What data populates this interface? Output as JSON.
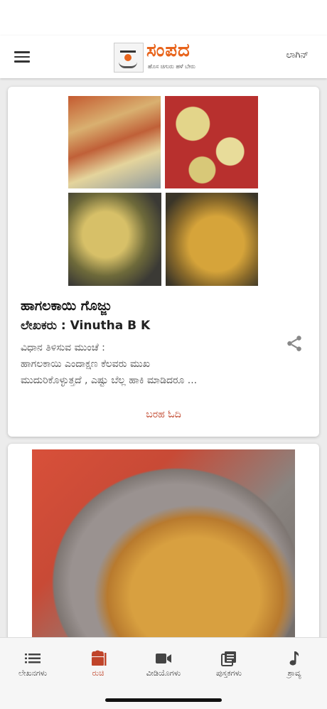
{
  "header": {
    "logo_title": "ಸಂಪದ",
    "logo_tagline": "ಹೊಸ ಚಿಗುರು ಹಳೆ ಬೇರು",
    "login_label": "ಲಾಗಿನ್"
  },
  "posts": [
    {
      "title": "ಹಾಗಲಕಾಯಿ ಗೊಜ್ಜು",
      "author": "ಲೇಖಕರು : Vinutha B K",
      "excerpt": [
        "ವಿಧಾನ ತಿಳಿಸುವ ಮುಂಚೆ :",
        "ಹಾಗಲಕಾಯಿ ಎಂದಾಕ್ಷಣ ಕೆಲವರು ಮುಖ",
        "ಮುದುರಿಕೊಳ್ಳುತ್ತದೆ , ಎಷ್ಟು ಬೆಲ್ಲ ಹಾಕಿ ಮಾಡಿದರೂ ..."
      ],
      "read_more": "ಬರಹ ಓದಿ",
      "image_icon": "recipe-photo-collage"
    },
    {
      "image_icon": "recipe-photo-rice-dish"
    }
  ],
  "bottom_nav": [
    {
      "label": "ಲೇಖನಗಳು",
      "icon": "list-icon",
      "active": false
    },
    {
      "label": "ರುಚಿ",
      "icon": "chef-icon",
      "active": true
    },
    {
      "label": "ವೀಡಿಯೊಗಳು",
      "icon": "video-camera-icon",
      "active": false
    },
    {
      "label": "ಪುಸ್ತಕಗಳು",
      "icon": "books-icon",
      "active": false
    },
    {
      "label": "ಶ್ರಾವ್ಯ",
      "icon": "music-note-icon",
      "active": false
    }
  ],
  "colors": {
    "accent": "#c0442a",
    "logo_orange": "#e8641c",
    "inactive_icon": "#444444"
  }
}
